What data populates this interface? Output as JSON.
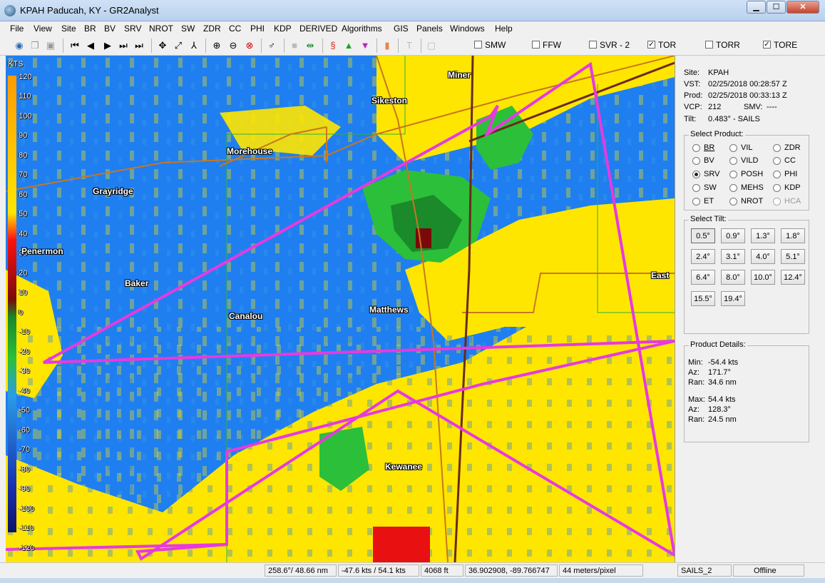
{
  "window": {
    "title": "KPAH Paducah, KY - GR2Analyst",
    "minimize_label": "▁",
    "maximize_label": "☐",
    "close_label": "✕"
  },
  "menu": [
    "File",
    "View",
    "Site",
    "BR",
    "BV",
    "SRV",
    "NROT",
    "SW",
    "ZDR",
    "CC",
    "PHI",
    "KDP",
    "DERIVED",
    "Algorithms",
    "GIS",
    "Panels",
    "Windows",
    "Help"
  ],
  "toolbar": {
    "icons": [
      "globe-icon",
      "copy-icon",
      "paste-icon",
      "first-frame-icon",
      "prev-frame-icon",
      "play-icon",
      "next-frame-icon",
      "last-frame-icon",
      "pan-icon",
      "measure-icon",
      "cross-section-icon",
      "zoom-in-icon",
      "zoom-out-icon",
      "zoom-reset-icon",
      "probe-icon",
      "stop-icon",
      "loop-icon",
      "storm-icon",
      "up-triangle-icon",
      "down-triangle-icon",
      "marker-icon",
      "text-icon",
      "layer-icon"
    ],
    "warning_toggles": [
      {
        "label": "SMW",
        "checked": false
      },
      {
        "label": "FFW",
        "checked": false
      },
      {
        "label": "SVR - 2",
        "checked": false
      },
      {
        "label": "TOR",
        "checked": true
      },
      {
        "label": "TORR",
        "checked": false
      },
      {
        "label": "TORE",
        "checked": true
      }
    ]
  },
  "color_scale": {
    "unit": "KTS",
    "labels": [
      "120",
      "110",
      "100",
      "90",
      "80",
      "70",
      "60",
      "50",
      "40",
      "30",
      "20",
      "10",
      "0",
      "-10",
      "-20",
      "-30",
      "-40",
      "-50",
      "-60",
      "-70",
      "-80",
      "-90",
      "-100",
      "-110",
      "-120"
    ]
  },
  "map": {
    "places": [
      "Miner",
      "Sikeston",
      "Morehouse",
      "Grayridge",
      "Penermon",
      "Baker",
      "Canalou",
      "Matthews",
      "East",
      "Kewanee"
    ],
    "colors": {
      "inbound_blue": "#1f7ff0",
      "light_blue": "#3a9be8",
      "yellow": "#ffe600",
      "green": "#2cbf3a",
      "dark_green": "#1a8a2a",
      "red": "#e81010",
      "dark_red": "#7a0a0a",
      "warning_polygon": "#e63adf",
      "road": "#c9761f",
      "highway": "#6b2a1a"
    }
  },
  "panel": {
    "site_label": "Site:",
    "site_value": "KPAH",
    "vst_label": "VST:",
    "vst_value": "02/25/2018  00:28:57 Z",
    "prod_label": "Prod:",
    "prod_value": "02/25/2018  00:33:13 Z",
    "vcp_label": "VCP:",
    "vcp_value": "212",
    "smv_label": "SMV:",
    "smv_value": "----",
    "tilt_label": "Tilt:",
    "tilt_value": "0.483° - SAILS",
    "select_product_title": "Select Product:",
    "products": [
      {
        "label": "BR",
        "selected": false,
        "enabled": true
      },
      {
        "label": "VIL",
        "selected": false,
        "enabled": true
      },
      {
        "label": "ZDR",
        "selected": false,
        "enabled": true
      },
      {
        "label": "BV",
        "selected": false,
        "enabled": true
      },
      {
        "label": "VILD",
        "selected": false,
        "enabled": true
      },
      {
        "label": "CC",
        "selected": false,
        "enabled": true
      },
      {
        "label": "SRV",
        "selected": true,
        "enabled": true
      },
      {
        "label": "POSH",
        "selected": false,
        "enabled": true
      },
      {
        "label": "PHI",
        "selected": false,
        "enabled": true
      },
      {
        "label": "SW",
        "selected": false,
        "enabled": true
      },
      {
        "label": "MEHS",
        "selected": false,
        "enabled": true
      },
      {
        "label": "KDP",
        "selected": false,
        "enabled": true
      },
      {
        "label": "ET",
        "selected": false,
        "enabled": true
      },
      {
        "label": "NROT",
        "selected": false,
        "enabled": true
      },
      {
        "label": "HCA",
        "selected": false,
        "enabled": false
      }
    ],
    "select_tilt_title": "Select Tilt:",
    "tilts": [
      "0.5°",
      "0.9°",
      "1.3°",
      "1.8°",
      "2.4°",
      "3.1°",
      "4.0°",
      "5.1°",
      "6.4°",
      "8.0°",
      "10.0°",
      "12.4°",
      "15.5°",
      "19.4°"
    ],
    "selected_tilt": "0.5°",
    "product_details_title": "Product Details:",
    "min_label": "Min:",
    "min_value": "-54.4 kts",
    "min_az_label": "Az:",
    "min_az_value": "171.7°",
    "min_ran_label": "Ran:",
    "min_ran_value": "34.6 nm",
    "max_label": "Max:",
    "max_value": "54.4 kts",
    "max_az_label": "Az:",
    "max_az_value": "128.3°",
    "max_ran_label": "Ran:",
    "max_ran_value": "24.5 nm"
  },
  "status": {
    "azimuth_range": "258.6°/ 48.66 nm",
    "velocity": "-47.6 kts / 54.1 kts",
    "height": "4068 ft",
    "coords": "36.902908, -89.766747",
    "resolution": "44 meters/pixel",
    "mode": "SAILS_2",
    "connection": "Offline"
  }
}
